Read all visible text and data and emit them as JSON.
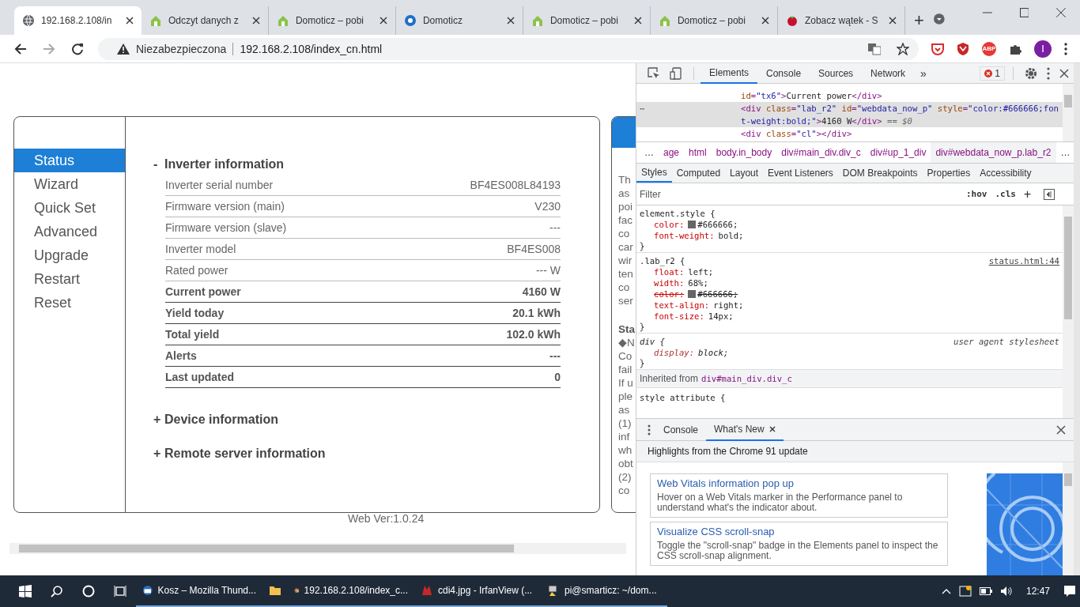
{
  "browser": {
    "tabs": [
      {
        "title": "192.168.2.108/in",
        "kind": "globe",
        "selected": true
      },
      {
        "title": "Odczyt danych z",
        "kind": "house",
        "selected": false
      },
      {
        "title": "Domoticz – pobi",
        "kind": "house",
        "selected": false
      },
      {
        "title": "Domoticz",
        "kind": "circle",
        "selected": false
      },
      {
        "title": "Domoticz – pobi",
        "kind": "house",
        "selected": false
      },
      {
        "title": "Domoticz – pobi",
        "kind": "house",
        "selected": false
      },
      {
        "title": "Zobacz wątek - S",
        "kind": "berry",
        "selected": false
      }
    ],
    "new_tab": "+",
    "security": "Niezabezpieczona",
    "url": "192.168.2.108/index_cn.html",
    "abp": "ABP",
    "avatar": "I"
  },
  "page": {
    "menu": [
      {
        "label": "Status",
        "selected": true
      },
      {
        "label": "Wizard",
        "selected": false
      },
      {
        "label": "Quick Set",
        "selected": false
      },
      {
        "label": "Advanced",
        "selected": false
      },
      {
        "label": "Upgrade",
        "selected": false
      },
      {
        "label": "Restart",
        "selected": false
      },
      {
        "label": "Reset",
        "selected": false
      }
    ],
    "sections": [
      {
        "sign": "-",
        "title": "Inverter information",
        "expanded": true,
        "rows": [
          {
            "label": "Inverter serial number",
            "value": "BF4ES008L84193",
            "bold": false
          },
          {
            "label": "Firmware version (main)",
            "value": "V230",
            "bold": false
          },
          {
            "label": "Firmware version (slave)",
            "value": "---",
            "bold": false
          },
          {
            "label": "Inverter model",
            "value": "BF4ES008",
            "bold": false
          },
          {
            "label": "Rated power",
            "value": "--- W",
            "bold": false
          },
          {
            "label": "Current power",
            "value": "4160 W",
            "bold": true
          },
          {
            "label": "Yield today",
            "value": "20.1 kWh",
            "bold": true
          },
          {
            "label": "Total yield",
            "value": "102.0 kWh",
            "bold": true
          },
          {
            "label": "Alerts",
            "value": "---",
            "bold": true
          },
          {
            "label": "Last updated",
            "value": "0",
            "bold": true
          }
        ]
      },
      {
        "sign": "+",
        "title": "Device information",
        "expanded": false
      },
      {
        "sign": "+",
        "title": "Remote server information",
        "expanded": false
      }
    ],
    "side_paragraphs": [
      [
        "Th",
        "as",
        "poi",
        "fac",
        "co",
        "car",
        "wir",
        "ten",
        "co",
        "ser"
      ],
      [
        "Sta",
        "◆N",
        "Co",
        "fail",
        "If u",
        "ple",
        "as",
        "(1)",
        "inf",
        "wh",
        "obt",
        "(2)",
        "co"
      ]
    ],
    "footer": "Web Ver:1.0.24"
  },
  "devtools": {
    "tabs": [
      {
        "label": "Elements",
        "selected": true
      },
      {
        "label": "Console",
        "selected": false
      },
      {
        "label": "Sources",
        "selected": false
      },
      {
        "label": "Network",
        "selected": false
      }
    ],
    "more": "»",
    "errors": "1",
    "dom": [
      {
        "selected": false,
        "parts": [
          {
            "kind": "attr",
            "text": "id"
          },
          {
            "kind": "tag",
            "text": "="
          },
          {
            "kind": "value",
            "text": "\"tx6\""
          },
          {
            "kind": "tag",
            "text": ">"
          },
          {
            "kind": "text",
            "text": "Current power"
          },
          {
            "kind": "tag",
            "text": "</div>"
          }
        ]
      },
      {
        "selected": true,
        "options": "⋯",
        "parts": [
          {
            "kind": "tag",
            "text": "<div "
          },
          {
            "kind": "attr",
            "text": "class"
          },
          {
            "kind": "tag",
            "text": "="
          },
          {
            "kind": "value",
            "text": "\"lab_r2\" "
          },
          {
            "kind": "attr",
            "text": "id"
          },
          {
            "kind": "tag",
            "text": "="
          },
          {
            "kind": "value",
            "text": "\"webdata_now_p\" "
          },
          {
            "kind": "attr",
            "text": "style"
          },
          {
            "kind": "tag",
            "text": "="
          },
          {
            "kind": "value",
            "text": "\"color:#666666;font-weight:bold;\""
          },
          {
            "kind": "tag",
            "text": ">"
          },
          {
            "kind": "text",
            "text": "4160 W"
          },
          {
            "kind": "tag",
            "text": "</div>"
          },
          {
            "kind": "note",
            "text": " == $0"
          }
        ]
      },
      {
        "selected": false,
        "parts": [
          {
            "kind": "tag",
            "text": "<div "
          },
          {
            "kind": "attr",
            "text": "class"
          },
          {
            "kind": "tag",
            "text": "="
          },
          {
            "kind": "value",
            "text": "\"cl\""
          },
          {
            "kind": "tag",
            "text": "></div>"
          }
        ]
      }
    ],
    "crumbs": [
      {
        "label": "…",
        "selected": false
      },
      {
        "label": "age",
        "selected": false
      },
      {
        "label": "html",
        "selected": false
      },
      {
        "label": "body.in_body",
        "selected": false
      },
      {
        "label": "div#main_div.div_c",
        "selected": false
      },
      {
        "label": "div#up_1_div",
        "selected": false
      },
      {
        "label": "div#webdata_now_p.lab_r2",
        "selected": true
      },
      {
        "label": "…",
        "selected": false
      }
    ],
    "pane_tabs": [
      {
        "label": "Styles",
        "selected": true
      },
      {
        "label": "Computed",
        "selected": false
      },
      {
        "label": "Layout",
        "selected": false
      },
      {
        "label": "Event Listeners",
        "selected": false
      },
      {
        "label": "DOM Breakpoints",
        "selected": false
      },
      {
        "label": "Properties",
        "selected": false
      },
      {
        "label": "Accessibility",
        "selected": false
      }
    ],
    "filter": {
      "placeholder": "Filter"
    },
    "hov": ":hov",
    "cls": ".cls",
    "add": "+",
    "rules": [
      {
        "selector": "element.style {",
        "italic": false,
        "props": [
          {
            "name": "color:",
            "value": "#666666;",
            "swatch": true,
            "struck": false
          },
          {
            "name": "font-weight:",
            "value": "bold;",
            "struck": false
          }
        ]
      },
      {
        "selector": ".lab_r2 {",
        "source": "status.html:44",
        "italic": false,
        "props": [
          {
            "name": "float:",
            "value": "left;",
            "struck": false
          },
          {
            "name": "width:",
            "value": "68%;",
            "struck": false
          },
          {
            "name": "color:",
            "value": "#666666;",
            "swatch": true,
            "struck": true
          },
          {
            "name": "text-align:",
            "value": "right;",
            "struck": false
          },
          {
            "name": "font-size:",
            "value": "14px;",
            "struck": false
          }
        ]
      },
      {
        "selector": "div {",
        "source": "user agent stylesheet",
        "italic": true,
        "props": [
          {
            "name": "display:",
            "value": "block;",
            "struck": false
          }
        ]
      }
    ],
    "inherited": {
      "label": "Inherited from",
      "selector": "div#main_div.div_c"
    },
    "last_rule": "style attribute {",
    "drawer": {
      "tabs": [
        {
          "label": "Console",
          "selected": false
        },
        {
          "label": "What's New",
          "selected": true
        }
      ],
      "heading": "Highlights from the Chrome 91 update",
      "cards": [
        {
          "title": "Web Vitals information pop up",
          "text": "Hover on a Web Vitals marker in the Performance panel to understand what's the indicator about."
        },
        {
          "title": "Visualize CSS scroll-snap",
          "text": "Toggle the \"scroll-snap\" badge in the Elements panel to inspect the CSS scroll-snap alignment."
        }
      ]
    }
  },
  "taskbar": {
    "apps": [
      {
        "label": "Kosz – Mozilla Thund...",
        "kind": "mail"
      },
      {
        "kind": "folder"
      },
      {
        "label": "192.168.2.108/index_c...",
        "kind": "chrome"
      },
      {
        "label": "cdi4.jpg - IrfanView (...",
        "kind": "irfan"
      },
      {
        "label": "pi@smarticz: ~/dom...",
        "kind": "putty"
      }
    ],
    "clock": "12:47"
  }
}
